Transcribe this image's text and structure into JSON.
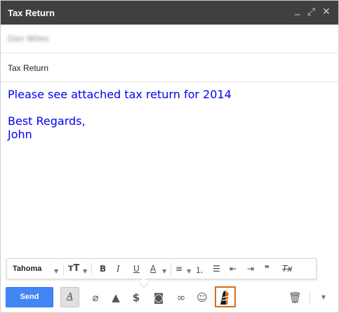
{
  "window": {
    "title": "Tax Return",
    "minimize_glyph": "_",
    "expand_glyph": "⤢",
    "close_glyph": "✕"
  },
  "to": {
    "recipient": "Dan Wiles"
  },
  "subject": {
    "value": "Tax Return"
  },
  "body": {
    "line1": "Please see attached tax return for 2014",
    "line2": "Best Regards,",
    "line3": "John",
    "text_color": "#0000ee"
  },
  "formatting_bar": {
    "font": "Tahoma",
    "items": [
      "font-size",
      "bold",
      "italic",
      "underline",
      "text-color",
      "align",
      "numbered-list",
      "bulleted-list",
      "indent-less",
      "indent-more",
      "quote",
      "remove-formatting"
    ]
  },
  "toolbar": {
    "send_label": "Send",
    "send_color": "#4285f4",
    "icons": [
      "formatting-options-icon",
      "attach-icon",
      "drive-icon",
      "money-icon",
      "photo-icon",
      "link-icon",
      "emoji-icon",
      "signature-icon",
      "trash-icon",
      "more-options-icon"
    ]
  }
}
